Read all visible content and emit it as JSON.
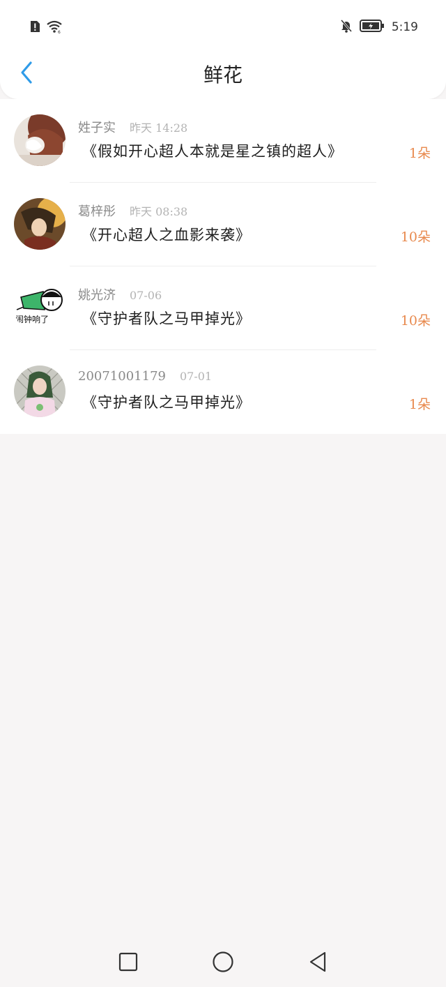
{
  "status_bar": {
    "time": "5:19",
    "icons": [
      "alert-sim-icon",
      "wifi-icon",
      "bell-off-icon",
      "battery-charging-icon"
    ]
  },
  "nav": {
    "title": "鲜花",
    "back_icon": "chevron-left-icon"
  },
  "colors": {
    "accent_blue": "#2f9be8",
    "count_orange": "#e8894d",
    "name_gray": "#8a8a8a",
    "time_gray": "#b3b3b3"
  },
  "items": [
    {
      "name": "姓子实",
      "time": "昨天 14:28",
      "book": "《假如开心超人本就是星之镇的超人》",
      "count": "1朵"
    },
    {
      "name": "葛梓彤",
      "time": "昨天 08:38",
      "book": "《开心超人之血影来袭》",
      "count": "10朵"
    },
    {
      "name": "姚光济",
      "time": "07-06",
      "book": "《守护者队之马甲掉光》",
      "count": "10朵",
      "avatar_caption": "闹钟响了"
    },
    {
      "name": "20071001179",
      "time": "07-01",
      "book": "《守护者队之马甲掉光》",
      "count": "1朵"
    }
  ],
  "system_nav": [
    "recent-apps-icon",
    "home-icon",
    "back-icon"
  ]
}
